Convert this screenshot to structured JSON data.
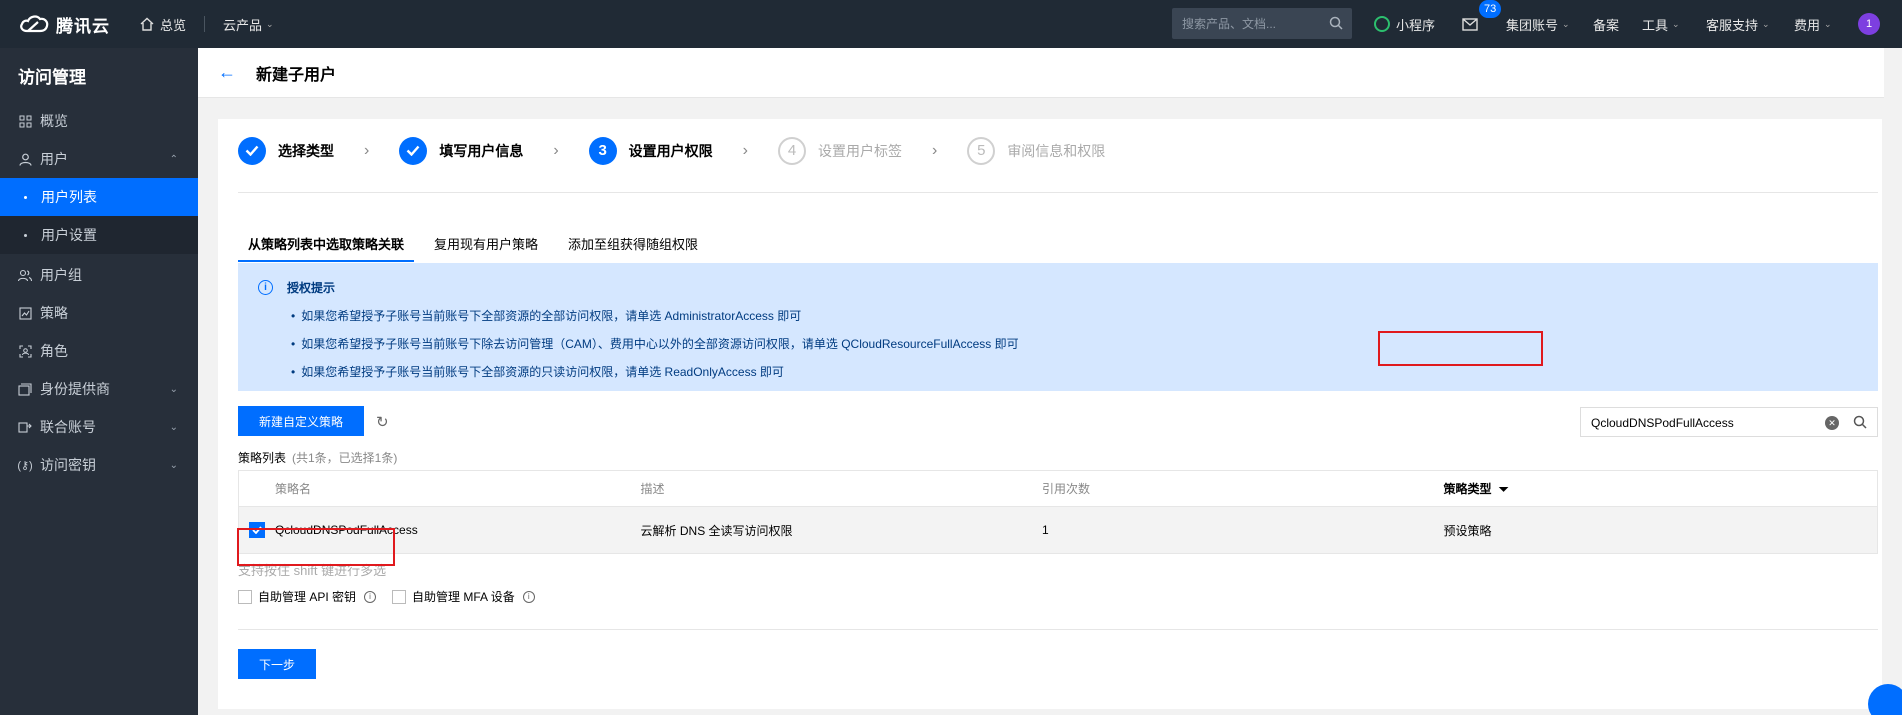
{
  "topbar": {
    "brand": "腾讯云",
    "home": "总览",
    "products": "云产品",
    "search_placeholder": "搜索产品、文档...",
    "mini_program": "小程序",
    "mail_count": "73",
    "group_account": "集团账号",
    "beian": "备案",
    "tools": "工具",
    "support": "客服支持",
    "billing": "费用",
    "avatar": "1"
  },
  "sidebar": {
    "title": "访问管理",
    "items": [
      {
        "label": "概览",
        "icon": "grid-icon"
      },
      {
        "label": "用户",
        "icon": "user-icon"
      },
      {
        "label": "用户列表"
      },
      {
        "label": "用户设置"
      },
      {
        "label": "用户组",
        "icon": "users-icon"
      },
      {
        "label": "策略",
        "icon": "policy-icon"
      },
      {
        "label": "角色",
        "icon": "role-icon"
      },
      {
        "label": "身份提供商",
        "icon": "idp-icon"
      },
      {
        "label": "联合账号",
        "icon": "federation-icon"
      },
      {
        "label": "访问密钥",
        "icon": "key-icon"
      }
    ]
  },
  "page": {
    "title": "新建子用户"
  },
  "steps": [
    {
      "num": "1",
      "label": "选择类型",
      "state": "done"
    },
    {
      "num": "2",
      "label": "填写用户信息",
      "state": "done"
    },
    {
      "num": "3",
      "label": "设置用户权限",
      "state": "current"
    },
    {
      "num": "4",
      "label": "设置用户标签",
      "state": "todo"
    },
    {
      "num": "5",
      "label": "审阅信息和权限",
      "state": "todo"
    }
  ],
  "tabs": [
    "从策略列表中选取策略关联",
    "复用现有用户策略",
    "添加至组获得随组权限"
  ],
  "notice": {
    "title": "授权提示",
    "lines": [
      "如果您希望授予子账号当前账号下全部资源的全部访问权限，请单选 AdministratorAccess 即可",
      "如果您希望授予子账号当前账号下除去访问管理（CAM）、费用中心以外的全部资源访问权限，请单选 QCloudResourceFullAccess 即可",
      "如果您希望授予子账号当前账号下全部资源的只读访问权限，请单选 ReadOnlyAccess 即可"
    ]
  },
  "toolbar": {
    "create_policy": "新建自定义策略",
    "search_value": "QcloudDNSPodFullAccess"
  },
  "list": {
    "title": "策略列表",
    "subtitle": "(共1条，已选择1条)",
    "columns": [
      "策略名",
      "描述",
      "引用次数",
      "策略类型"
    ],
    "rows": [
      {
        "name": "QcloudDNSPodFullAccess",
        "desc": "云解析 DNS 全读写访问权限",
        "refs": "1",
        "type": "预设策略",
        "checked": true
      }
    ]
  },
  "hint": "支持按住 shift 键进行多选",
  "options": [
    "自助管理 API 密钥",
    "自助管理 MFA 设备"
  ],
  "next_button": "下一步",
  "colors": {
    "accent": "#006eff",
    "topbar": "#202a35",
    "sidebar": "#272f3a",
    "highlight": "#e0191d"
  }
}
